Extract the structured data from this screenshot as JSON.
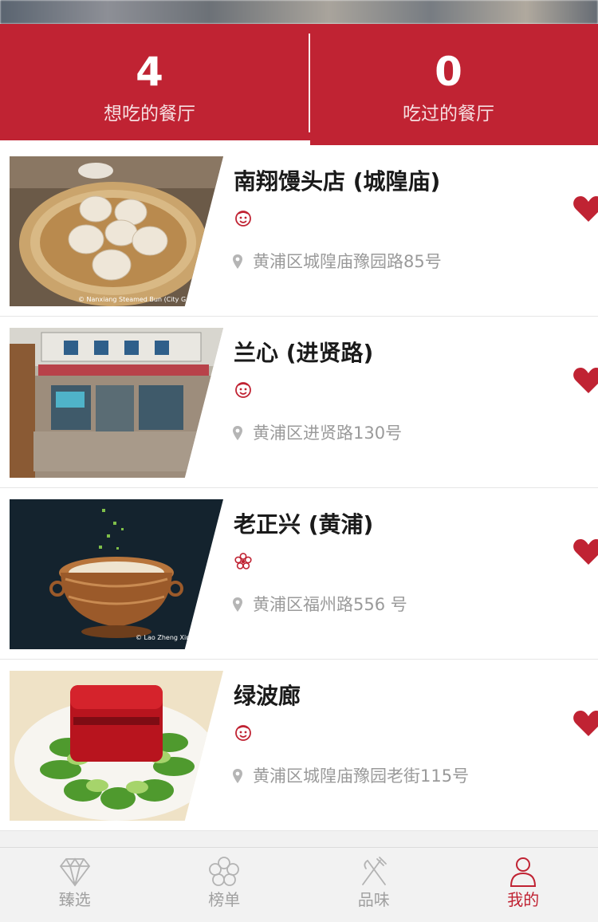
{
  "header": {
    "want_count": "4",
    "want_label": "想吃的餐厅",
    "visited_count": "0",
    "visited_label": "吃过的餐厅"
  },
  "restaurants": [
    {
      "name": "南翔馒头店 (城隍庙)",
      "badge_icon": "bib-gourmand-icon",
      "address": "黄浦区城隍庙豫园路85号",
      "photo_credit": "© Nanxiang Steamed Bun (City G",
      "favorited": true
    },
    {
      "name": "兰心 (进贤路)",
      "badge_icon": "bib-gourmand-icon",
      "address": "黄浦区进贤路130号",
      "photo_credit": "",
      "favorited": true
    },
    {
      "name": "老正兴 (黄浦)",
      "badge_icon": "michelin-star-icon",
      "address": "黄浦区福州路556 号",
      "photo_credit": "© Lao Zheng Xin",
      "favorited": true
    },
    {
      "name": "绿波廊",
      "badge_icon": "bib-gourmand-icon",
      "address": "黄浦区城隍庙豫园老街115号",
      "photo_credit": "",
      "favorited": true
    }
  ],
  "tabbar": {
    "items": [
      {
        "label": "臻选",
        "icon": "diamond-icon"
      },
      {
        "label": "榜单",
        "icon": "clover-icon"
      },
      {
        "label": "品味",
        "icon": "fork-knife-icon"
      },
      {
        "label": "我的",
        "icon": "person-icon",
        "active": true
      }
    ]
  },
  "colors": {
    "brand": "#c02333",
    "text_gray": "#9a9a9a"
  }
}
